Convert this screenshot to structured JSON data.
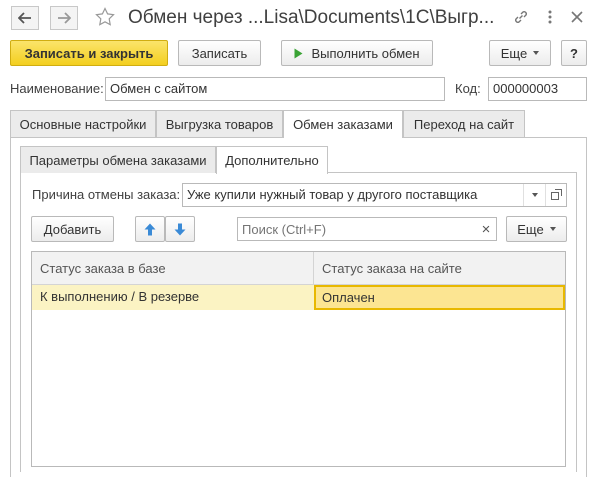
{
  "window": {
    "title": "Обмен через ...Lisa\\Documents\\1C\\Выгр...",
    "icons": [
      "back-arrow-icon",
      "forward-arrow-icon",
      "star-icon",
      "link-icon",
      "more-vertical-icon",
      "close-icon"
    ]
  },
  "toolbar": {
    "save_close_label": "Записать и закрыть",
    "save_label": "Записать",
    "run_exchange_label": "Выполнить обмен",
    "more_label": "Еще",
    "help_label": "?"
  },
  "form": {
    "name_label": "Наименование:",
    "name_value": "Обмен с сайтом",
    "code_label": "Код:",
    "code_value": "000000003"
  },
  "tabs": [
    {
      "label": "Основные настройки"
    },
    {
      "label": "Выгрузка товаров"
    },
    {
      "label": "Обмен заказами"
    },
    {
      "label": "Переход на сайт"
    }
  ],
  "subtabs": [
    {
      "label": "Параметры обмена заказами"
    },
    {
      "label": "Дополнительно"
    }
  ],
  "cancel_reason": {
    "label": "Причина отмены заказа:",
    "value": "Уже купили нужный товар у другого поставщика"
  },
  "table_toolbar": {
    "add_label": "Добавить",
    "search_placeholder": "Поиск (Ctrl+F)",
    "clear_label": "×",
    "more_label": "Еще"
  },
  "table": {
    "columns": [
      "Статус заказа в базе",
      "Статус заказа на сайте"
    ],
    "rows": [
      [
        "К выполнению / В резерве",
        "Оплачен"
      ]
    ]
  },
  "colors": {
    "primary_button": "#f3cf1f",
    "selected_row": "#fbf3c3",
    "selected_cell": "#fce592",
    "selected_cell_border": "#e8b800",
    "arrow_blue": "#3a8ad6",
    "run_green": "#3aa335"
  }
}
